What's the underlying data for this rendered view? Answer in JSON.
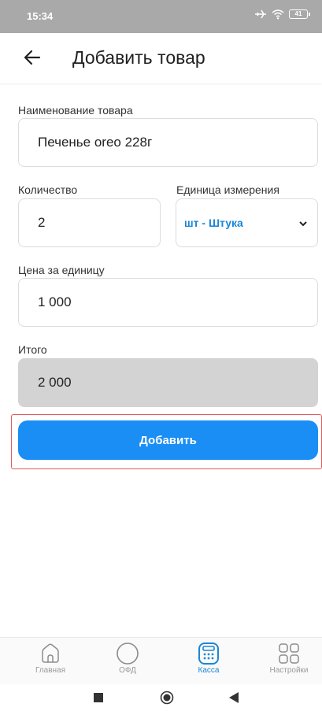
{
  "status": {
    "time": "15:34",
    "battery": "41"
  },
  "header": {
    "title": "Добавить товар"
  },
  "form": {
    "name_label": "Наименование товара",
    "name_value": "Печенье oreo 228г",
    "qty_label": "Количество",
    "qty_value": "2",
    "unit_label": "Единица измерения",
    "unit_value": "шт - Штука",
    "price_label": "Цена за единицу",
    "price_value": "1 000",
    "total_label": "Итого",
    "total_value": "2 000"
  },
  "actions": {
    "add_label": "Добавить"
  },
  "bottom_nav": {
    "items": [
      {
        "label": "Главная",
        "icon": "home-icon"
      },
      {
        "label": "ОФД",
        "icon": "circle-icon"
      },
      {
        "label": "Касса",
        "icon": "calculator-icon",
        "active": true
      },
      {
        "label": "Настройки",
        "icon": "grid-icon"
      }
    ]
  },
  "colors": {
    "accent": "#1a8ef5",
    "active_nav": "#1a86d8",
    "highlight": "#e35b5b"
  }
}
